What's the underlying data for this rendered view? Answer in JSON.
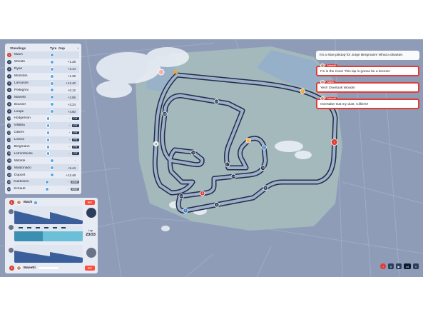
{
  "standings": {
    "headers": {
      "name": "Standings",
      "tyre": "Tyre",
      "gap": "Gap",
      "more": "›"
    },
    "rows": [
      {
        "pos": "1",
        "name": "Mach",
        "gap": "",
        "tag": ""
      },
      {
        "pos": "2",
        "name": "Woods",
        "gap": "+1.28",
        "tag": ""
      },
      {
        "pos": "3",
        "name": "Ryan",
        "gap": "+3.44",
        "tag": ""
      },
      {
        "pos": "4",
        "name": "Monstan",
        "gap": "+1.28",
        "tag": ""
      },
      {
        "pos": "5",
        "name": "Larousse",
        "gap": "+12.40",
        "tag": ""
      },
      {
        "pos": "6",
        "name": "Pellegrini",
        "gap": "+0.12",
        "tag": ""
      },
      {
        "pos": "7",
        "name": "Manetti",
        "gap": "+2.56",
        "tag": ""
      },
      {
        "pos": "8",
        "name": "Bouvier",
        "gap": "+3.24",
        "tag": ""
      },
      {
        "pos": "9",
        "name": "Loupe",
        "gap": "+4.80",
        "tag": ""
      },
      {
        "pos": "10",
        "name": "Hodgerson",
        "gap": "-",
        "tag": "PIT"
      },
      {
        "pos": "11",
        "name": "Villalba",
        "gap": "-",
        "tag": "PIT"
      },
      {
        "pos": "12",
        "name": "Cilliers",
        "gap": "-",
        "tag": "PIT"
      },
      {
        "pos": "13",
        "name": "Lovera",
        "gap": "-",
        "tag": "PIT"
      },
      {
        "pos": "14",
        "name": "Bregmann",
        "gap": "-",
        "tag": "PIT"
      },
      {
        "pos": "15",
        "name": "Lefrombiose",
        "gap": "-",
        "tag": "PIT"
      },
      {
        "pos": "16",
        "name": "Mitoste",
        "gap": "-",
        "tag": ""
      },
      {
        "pos": "17",
        "name": "Maldonado",
        "gap": "+5.44",
        "tag": ""
      },
      {
        "pos": "18",
        "name": "Dupont",
        "gap": "+12.48",
        "tag": ""
      },
      {
        "pos": "19",
        "name": "Kukkonen",
        "gap": "-",
        "tag": "DNF"
      },
      {
        "pos": "20",
        "name": "Schaub",
        "gap": "-",
        "tag": "DNF"
      }
    ]
  },
  "driver_panel": {
    "top_driver": {
      "number": "1",
      "name": "Mach",
      "pit": "PIT"
    },
    "bottom_driver": {
      "number": "7",
      "name": "Manetti",
      "pit": "PIT"
    },
    "lap_label": "Lap",
    "lap_value": "23/33"
  },
  "radio": {
    "intro": "It's a slow pitstop for Jorge Bregmann! What a disaster.",
    "messages": [
      {
        "driver": "Manetti",
        "text": "I'm in the zone! This lap is gonna be a breeze!"
      },
      {
        "driver": "Mach",
        "text": "Yes!! Overtook Woods!"
      },
      {
        "driver": "Manetti",
        "text": "Overtake! Eat my dust, Cilliers!!"
      }
    ]
  },
  "controls": {
    "speed": "x4",
    "pause": "II",
    "play": "▶"
  },
  "car_markers": [
    "1",
    "7",
    "5",
    "4",
    "6",
    "18",
    "8",
    "14",
    "12",
    "15",
    "13",
    "17",
    "19",
    "16",
    "20",
    "11"
  ],
  "colors": {
    "accent": "#e23c36",
    "panel": "#2c3e5c",
    "track_area": "#a7bdb9",
    "background": "#8e9cb8"
  }
}
